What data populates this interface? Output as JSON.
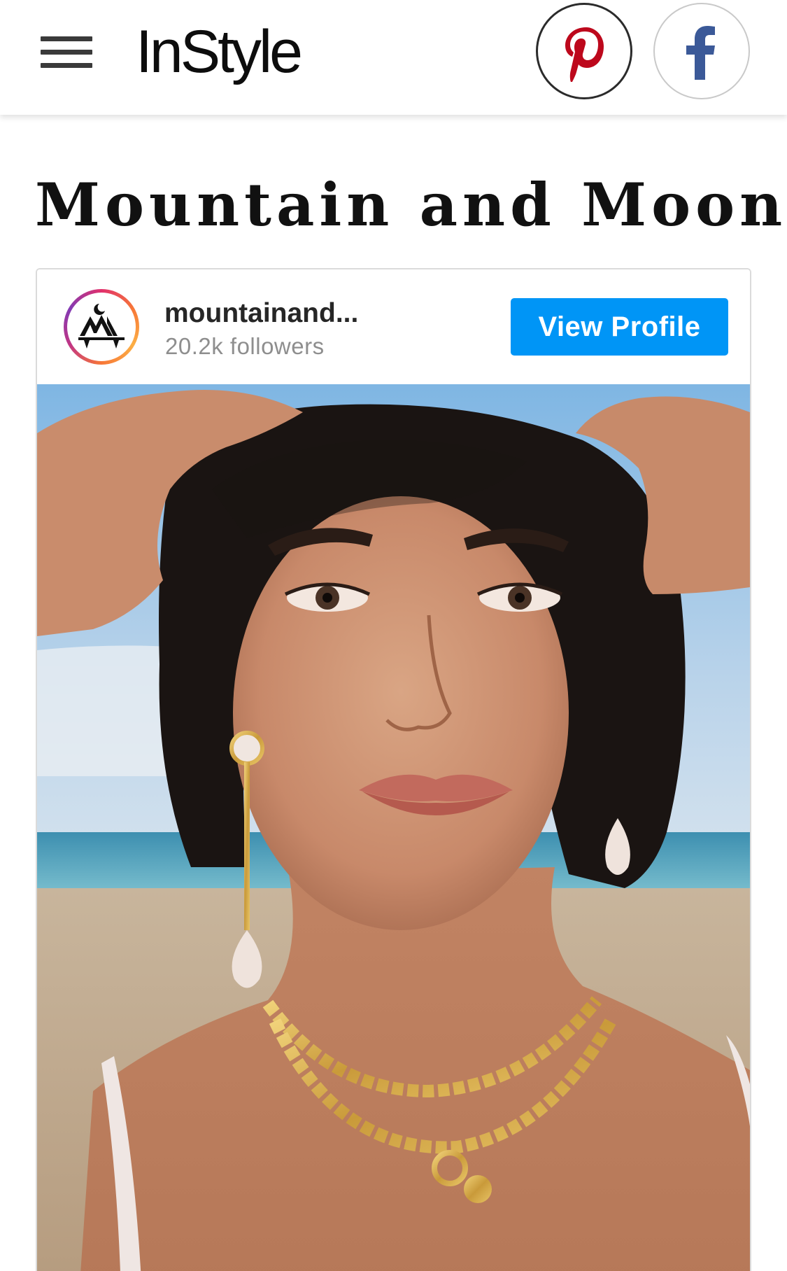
{
  "header": {
    "logo": "InStyle",
    "menu_icon": "hamburger-menu-icon",
    "share": {
      "pinterest_icon": "pinterest-icon",
      "pinterest_color": "#bd081c",
      "facebook_icon": "facebook-icon",
      "facebook_color": "#3b5998"
    }
  },
  "article": {
    "title": "Mountain and Moon"
  },
  "embed": {
    "username": "mountainand...",
    "followers": "20.2k followers",
    "view_profile_label": "View Profile",
    "button_color": "#0095f6",
    "avatar_icon": "mountain-and-moon-logo-icon",
    "photo_alt": "Instagram post photo"
  }
}
